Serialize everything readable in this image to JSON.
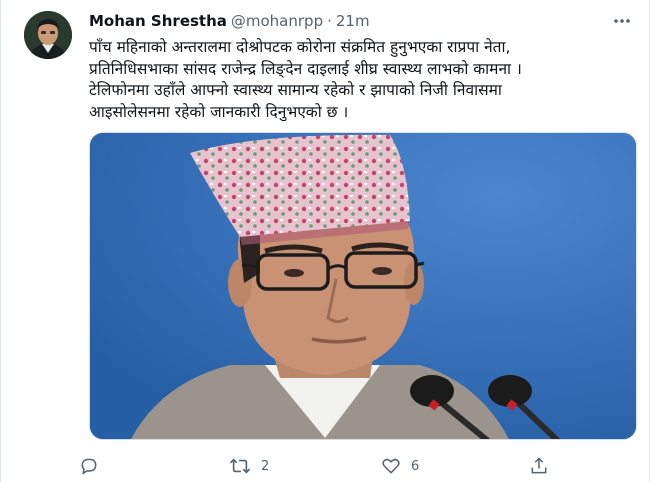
{
  "author": {
    "name": "Mohan Shrestha",
    "handle": "@mohanrpp",
    "separator": "·",
    "time": "21m"
  },
  "tweet": {
    "lines": [
      "पाँच महिनाको अन्तरालमा दोश्रोपटक कोरोना संक्रमित हुनुभएका राप्रपा नेता,",
      "प्रतिनिधिसभाका सांसद राजेन्द्र लिङ्देन दाइलाई शीघ्र स्वास्थ्य लाभको कामना ।",
      "टेलिफोनमा उहाँले आफ्नो स्वास्थ्य सामान्य रहेको र झापाको निजी निवासमा",
      "आइसोलेसनमा रहेको जानकारी दिनुभएको छ ।"
    ]
  },
  "actions": {
    "reply_count": "",
    "retweet_count": "2",
    "like_count": "6"
  },
  "icons": {
    "more": "more-horizontal-icon",
    "reply": "reply-icon",
    "retweet": "retweet-icon",
    "like": "heart-icon",
    "share": "share-icon"
  },
  "colors": {
    "text": "#0f1419",
    "secondary": "#536471",
    "border": "#e1e8ed",
    "photo_background": "#2f6bb3"
  }
}
